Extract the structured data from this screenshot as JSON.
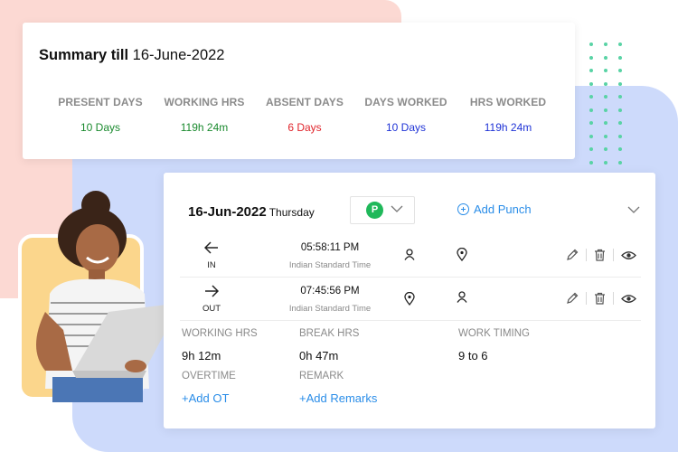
{
  "summary": {
    "title_bold": "Summary till",
    "title_date": "16-June-2022",
    "stats": [
      {
        "label": "PRESENT DAYS",
        "value": "10 Days",
        "color": "#1a8a2e"
      },
      {
        "label": "WORKING HRS",
        "value": "119h 24m",
        "color": "#1a8a2e"
      },
      {
        "label": "ABSENT DAYS",
        "value": "6 Days",
        "color": "#e0242b"
      },
      {
        "label": "DAYS WORKED",
        "value": "10 Days",
        "color": "#1f33d6"
      },
      {
        "label": "HRS WORKED",
        "value": "119h 24m",
        "color": "#1f33d6"
      }
    ]
  },
  "attendance": {
    "date": "16-Jun-2022",
    "weekday": "Thursday",
    "status_badge": "P",
    "add_punch_label": "Add Punch",
    "punches": [
      {
        "direction": "IN",
        "time": "05:58:11 PM",
        "timezone": "Indian Standard Time",
        "icons": [
          "user-icon",
          "location-pin-icon"
        ]
      },
      {
        "direction": "OUT",
        "time": "07:45:56 PM",
        "timezone": "Indian Standard Time",
        "icons": [
          "location-pin-icon",
          "user-icon"
        ]
      }
    ],
    "details": {
      "working_hrs_label": "WORKING HRS",
      "working_hrs_value": "9h 12m",
      "break_hrs_label": "BREAK HRS",
      "break_hrs_value": "0h 47m",
      "work_timing_label": "WORK TIMING",
      "work_timing_value": "9 to 6",
      "overtime_label": "OVERTIME",
      "add_ot_label": "+Add OT",
      "remark_label": "REMARK",
      "add_remarks_label": "+Add Remarks"
    }
  },
  "colors": {
    "accent_blue": "#2a8de8",
    "present_green": "#1fb85a",
    "bg_pink": "#fcd9d3",
    "bg_blue": "#cddafb",
    "dots_teal": "#59d3a5"
  }
}
